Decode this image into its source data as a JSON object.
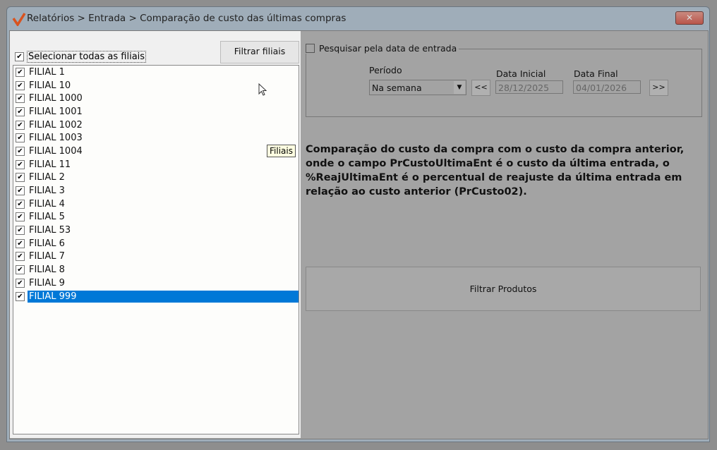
{
  "window": {
    "title": "Relatórios > Entrada > Comparação de custo das últimas compras",
    "close_label": "✕"
  },
  "left": {
    "select_all_label": "Selecionar todas as filiais",
    "select_all_checked": true,
    "filter_button": "Filtrar filiais",
    "items": [
      {
        "label": "FILIAL 1",
        "checked": true
      },
      {
        "label": "FILIAL 10",
        "checked": true
      },
      {
        "label": "FILIAL 1000",
        "checked": true
      },
      {
        "label": "FILIAL 1001",
        "checked": true
      },
      {
        "label": "FILIAL 1002",
        "checked": true
      },
      {
        "label": "FILIAL 1003",
        "checked": true
      },
      {
        "label": "FILIAL 1004",
        "checked": true
      },
      {
        "label": "FILIAL 11",
        "checked": true
      },
      {
        "label": "FILIAL 2",
        "checked": true
      },
      {
        "label": "FILIAL 3",
        "checked": true
      },
      {
        "label": "FILIAL 4",
        "checked": true
      },
      {
        "label": "FILIAL 5",
        "checked": true
      },
      {
        "label": "FILIAL 53",
        "checked": true
      },
      {
        "label": "FILIAL 6",
        "checked": true
      },
      {
        "label": "FILIAL 7",
        "checked": true
      },
      {
        "label": "FILIAL 8",
        "checked": true
      },
      {
        "label": "FILIAL 9",
        "checked": true
      },
      {
        "label": "FILIAL 999",
        "checked": true,
        "selected": true
      }
    ],
    "tooltip": "Filiais"
  },
  "right": {
    "date_search_label": "Pesquisar pela data de entrada",
    "date_search_checked": false,
    "period_label": "Período",
    "period_value": "Na semana",
    "prev_button": "<<",
    "next_button": ">>",
    "start_label": "Data Inicial",
    "start_value": "28/12/2025",
    "end_label": "Data Final",
    "end_value": "04/01/2026",
    "description": "Comparação do custo da compra com o custo da compra anterior, onde o campo PrCustoUltimaEnt é o custo da última entrada, o %ReajUltimaEnt é o percentual de reajuste da última entrada em relação ao custo anterior (PrCusto02).",
    "filter_products_button": "Filtrar Produtos"
  },
  "colors": {
    "selection": "#0078d7",
    "close": "#b9554a"
  }
}
